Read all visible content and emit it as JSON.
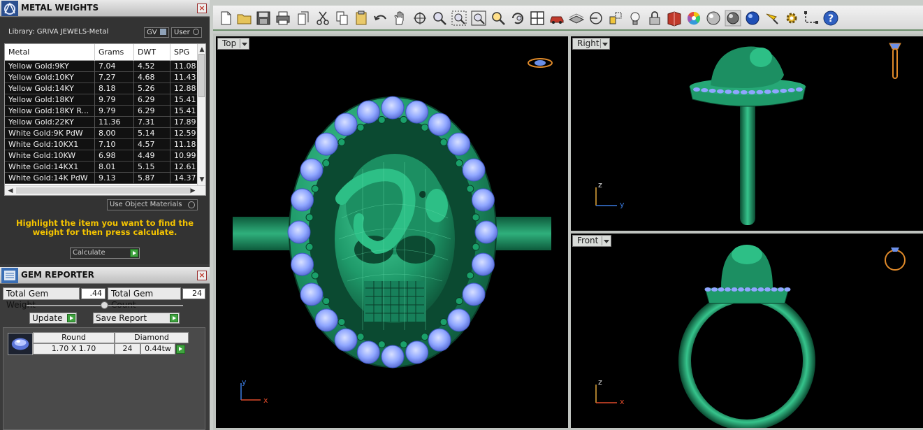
{
  "metal_weights": {
    "title": "METAL WEIGHTS",
    "library_label": "Library: GRIVA JEWELS-Metal",
    "gv_label": "GV",
    "user_label": "User",
    "columns": [
      "Metal",
      "Grams",
      "DWT",
      "SPG"
    ],
    "rows": [
      [
        "Yellow Gold:9KY",
        "7.04",
        "4.52",
        "11.08"
      ],
      [
        "Yellow Gold:10KY",
        "7.27",
        "4.68",
        "11.43"
      ],
      [
        "Yellow Gold:14KY",
        "8.18",
        "5.26",
        "12.88"
      ],
      [
        "Yellow Gold:18KY",
        "9.79",
        "6.29",
        "15.41"
      ],
      [
        "Yellow Gold:18KY R...",
        "9.79",
        "6.29",
        "15.41"
      ],
      [
        "Yellow Gold:22KY",
        "11.36",
        "7.31",
        "17.89"
      ],
      [
        "White Gold:9K PdW",
        "8.00",
        "5.14",
        "12.59"
      ],
      [
        "White Gold:10KX1",
        "7.10",
        "4.57",
        "11.18"
      ],
      [
        "White Gold:10KW",
        "6.98",
        "4.49",
        "10.99"
      ],
      [
        "White Gold:14KX1",
        "8.01",
        "5.15",
        "12.61"
      ],
      [
        "White Gold:14K PdW",
        "9.13",
        "5.87",
        "14.37"
      ]
    ],
    "use_object_materials": "Use Object Materials",
    "hint": "Highlight the item you want to find the weight for then press calculate.",
    "calculate_label": "Calculate"
  },
  "gem_reporter": {
    "title": "GEM REPORTER",
    "total_weight_label": "Total Gem Weight",
    "total_weight_value": ".44",
    "total_count_label": "Total Gem Count",
    "total_count_value": "24",
    "update_label": "Update",
    "save_report_label": "Save Report",
    "gem": {
      "shape": "Round",
      "size": "1.70 X 1.70",
      "type": "Diamond",
      "count": "24",
      "weight": "0.44tw"
    }
  },
  "toolbar": {
    "icons": [
      "new-file-icon",
      "open-folder-icon",
      "save-icon",
      "print-icon",
      "copy-doc-icon",
      "cut-icon",
      "copy-icon",
      "paste-icon",
      "undo-icon",
      "pan-hand-icon",
      "rotate-view-icon",
      "zoom-icon",
      "zoom-window-icon",
      "zoom-extents-icon",
      "zoom-selected-icon",
      "rotate-camera-icon",
      "four-viewports-icon",
      "car-icon",
      "layer-icon",
      "target-icon",
      "snap-icon",
      "light-icon",
      "lock-icon",
      "material-book-icon",
      "color-wheel-icon",
      "sphere-white-icon",
      "sphere-grey-icon",
      "sphere-blue-icon",
      "spotlight-icon",
      "gear-icon",
      "dimension-icon",
      "help-icon"
    ]
  },
  "viewports": {
    "top": {
      "label": "Top",
      "axis_a": "y",
      "axis_b": "x"
    },
    "right": {
      "label": "Right",
      "axis_a": "z",
      "axis_b": "y"
    },
    "front": {
      "label": "Front",
      "axis_a": "z",
      "axis_b": "x"
    }
  },
  "colors": {
    "ring_green": "#1f9a6a",
    "gem_blue": "#8fa6ff",
    "hint_yellow": "#f5c400",
    "toolbar_accent": "#6d8f6d"
  }
}
